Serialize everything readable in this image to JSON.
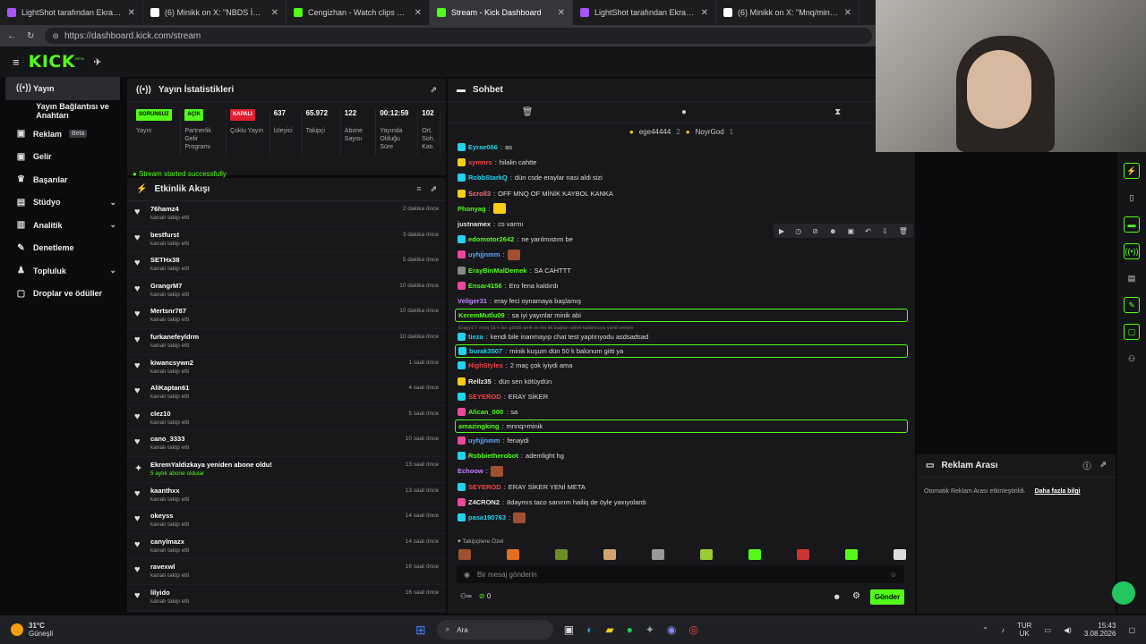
{
  "tabs": [
    {
      "title": "LightShot tarafından Ekran Görün",
      "fav": "#a855f7",
      "active": false
    },
    {
      "title": "(6) Minikk on X: \"NBDS İFSA :) http:",
      "fav": "#ffffff",
      "active": false
    },
    {
      "title": "Cengizhan - Watch clips on Kick",
      "fav": "#53fc18",
      "active": false
    },
    {
      "title": "Stream - Kick Dashboard",
      "fav": "#53fc18",
      "active": true
    },
    {
      "title": "LightShot tarafından Ekran Görün",
      "fav": "#a855f7",
      "active": false
    },
    {
      "title": "(6) Minikk on X: \"Mnq/minik http:",
      "fav": "#ffffff",
      "active": false
    }
  ],
  "url": "https://dashboard.kick.com/stream",
  "logo": "KICK",
  "logo_sup": "BETA",
  "nav": [
    {
      "label": "Yayın",
      "icon": "((•))",
      "active": true,
      "chev": false,
      "beta": false
    },
    {
      "label": "Yayın Bağlantısı ve Anahtarı",
      "icon": "",
      "active": false,
      "chev": false,
      "beta": false
    },
    {
      "label": "Reklam",
      "icon": "▣",
      "active": false,
      "chev": false,
      "beta": true
    },
    {
      "label": "Gelir",
      "icon": "▣",
      "active": false,
      "chev": false,
      "beta": false
    },
    {
      "label": "Başarılar",
      "icon": "♛",
      "active": false,
      "chev": false,
      "beta": false
    },
    {
      "label": "Stüdyo",
      "icon": "▤",
      "active": false,
      "chev": true,
      "beta": false
    },
    {
      "label": "Analitik",
      "icon": "▥",
      "active": false,
      "chev": true,
      "beta": false
    },
    {
      "label": "Denetleme",
      "icon": "✎",
      "active": false,
      "chev": false,
      "beta": false
    },
    {
      "label": "Topluluk",
      "icon": "♟",
      "active": false,
      "chev": true,
      "beta": false
    },
    {
      "label": "Droplar ve ödüller",
      "icon": "▢",
      "active": false,
      "chev": false,
      "beta": false
    }
  ],
  "beta_label": "Beta",
  "stats": {
    "title": "Yayın İstatistikleri",
    "items": [
      {
        "value": "SORUNSUZ",
        "label": "Yayın",
        "badge": "#53fc18"
      },
      {
        "value": "AÇIK",
        "label": "Partnerlik Gelir Programı",
        "badge": "#53fc18"
      },
      {
        "value": "KAPALI",
        "label": "Çoklu Yayın",
        "badge": "#e11d2e"
      },
      {
        "value": "637",
        "label": "İzleyici",
        "badge": ""
      },
      {
        "value": "65.972",
        "label": "Takipçi",
        "badge": ""
      },
      {
        "value": "122",
        "label": "Abone Sayısı",
        "badge": ""
      },
      {
        "value": "00:12:59",
        "label": "Yayında Olduğu Süre",
        "badge": ""
      },
      {
        "value": "102",
        "label": "Ort. Soh. Katı.",
        "badge": ""
      }
    ],
    "ok": "Stream started successfully"
  },
  "activity": {
    "title": "Etkinlik Akışı",
    "rows": [
      {
        "name": "76hamz4",
        "sub": "kanalı takip etti",
        "time": "2 dakika önce",
        "icon": "♥"
      },
      {
        "name": "bestfurst",
        "sub": "kanalı takip etti",
        "time": "3 dakika önce",
        "icon": "♥"
      },
      {
        "name": "SETHx38",
        "sub": "kanalı takip etti",
        "time": "5 dakika önce",
        "icon": "♥"
      },
      {
        "name": "GrangrM7",
        "sub": "kanalı takip etti",
        "time": "10 dakika önce",
        "icon": "♥"
      },
      {
        "name": "Mertsnr787",
        "sub": "kanalı takip etti",
        "time": "10 dakika önce",
        "icon": "♥"
      },
      {
        "name": "furkanefeyldrm",
        "sub": "kanalı takip etti",
        "time": "10 dakika önce",
        "icon": "♥"
      },
      {
        "name": "kiwancsywn2",
        "sub": "kanalı takip etti",
        "time": "1 saat önce",
        "icon": "♥"
      },
      {
        "name": "AliKaptan61",
        "sub": "kanalı takip etti",
        "time": "4 saat önce",
        "icon": "♥"
      },
      {
        "name": "clez10",
        "sub": "kanalı takip etti",
        "time": "5 saat önce",
        "icon": "♥"
      },
      {
        "name": "cano_3333",
        "sub": "kanalı takip etti",
        "time": "10 saat önce",
        "icon": "♥"
      },
      {
        "name": "EkremYaldizkaya yeniden abone oldu!",
        "sub": "5 aylık abone oldular",
        "time": "13 saat önce",
        "icon": "✦"
      },
      {
        "name": "kaanthxx",
        "sub": "kanalı takip etti",
        "time": "13 saat önce",
        "icon": "♥"
      },
      {
        "name": "okeyss",
        "sub": "kanalı takip etti",
        "time": "14 saat önce",
        "icon": "♥"
      },
      {
        "name": "canylmazx",
        "sub": "kanalı takip etti",
        "time": "14 saat önce",
        "icon": "♥"
      },
      {
        "name": "ravexwl",
        "sub": "kanalı takip etti",
        "time": "16 saat önce",
        "icon": "♥"
      },
      {
        "name": "lilyido",
        "sub": "kanalı takip etti",
        "time": "16 saat önce",
        "icon": "♥"
      }
    ]
  },
  "chat": {
    "title": "Sohbet",
    "pinned": [
      {
        "name": "ege44444",
        "n": "2"
      },
      {
        "name": "NoyrGod",
        "n": "1"
      }
    ],
    "messages": [
      {
        "user": "Eyrae066",
        "color": "#22d3ee",
        "text": "as",
        "badge": "#22d3ee",
        "hl": false,
        "emote": false
      },
      {
        "user": "symnrs",
        "color": "#ef4444",
        "text": "hilalin cahtte",
        "badge": "#facc15",
        "hl": false,
        "emote": false
      },
      {
        "user": "RobbStarkQ",
        "color": "#22d3ee",
        "text": "dün csde eraylar nasi aldi sizi",
        "badge": "#22d3ee",
        "hl": false,
        "emote": false
      },
      {
        "user": "Scroll3",
        "color": "#f87171",
        "text": "OFF MNQ OF MİNİK KAYBOL KANKA",
        "badge": "#facc15",
        "hl": false,
        "emote": false
      },
      {
        "user": "Phonyag",
        "color": "#53fc18",
        "text": "",
        "badge": "",
        "hl": false,
        "emote": true
      },
      {
        "user": "justnamex",
        "color": "#e5e5e5",
        "text": "cs varmı",
        "badge": "",
        "hl": false,
        "emote": false
      },
      {
        "user": "edomotor2642",
        "color": "#53fc18",
        "text": "ne yarılmıstım be",
        "badge": "#22d3ee",
        "hl": false,
        "emote": false
      },
      {
        "user": "uyhjjnmm",
        "color": "#60a5fa",
        "text": "",
        "badge": "#ec4899",
        "hl": false,
        "emote": true
      },
      {
        "user": "ErayBinMalDemek",
        "color": "#53fc18",
        "text": "SA CAHTTT",
        "badge": "#888888",
        "hl": false,
        "emote": false
      },
      {
        "user": "Ensar4156",
        "color": "#53fc18",
        "text": "Ero fena kaldırdı",
        "badge": "#ec4899",
        "hl": false,
        "emote": false
      },
      {
        "user": "Veliger31",
        "color": "#c084fc",
        "text": "eray feci oynamaya başlamış",
        "badge": "",
        "hl": false,
        "emote": false
      },
      {
        "user": "KeremMutlu09",
        "color": "#53fc18",
        "text": "sa iyi yayınlar minik abi",
        "badge": "",
        "hl": true,
        "emote": false
      },
      {
        "user": "tieza",
        "color": "#22d3ee",
        "text": "kendi bile inanmayıp chat test yaptırıyodu asdsadsad",
        "badge": "#22d3ee",
        "hl": false,
        "emote": false
      },
      {
        "user": "burak3507",
        "color": "#22d3ee",
        "text": "minik kuşum dün 50 k balonum gitti ya",
        "badge": "#22d3ee",
        "hl": true,
        "emote": false
      },
      {
        "user": "HighStyles",
        "color": "#ef4444",
        "text": "2 maç çok iyiydi ama",
        "badge": "#22d3ee",
        "hl": false,
        "emote": false
      },
      {
        "user": "Rellz35",
        "color": "#e5e5e5",
        "text": "dün sen kötüydün",
        "badge": "#facc15",
        "hl": false,
        "emote": false
      },
      {
        "user": "SEYEROD",
        "color": "#ef4444",
        "text": "ERAY SİKER",
        "badge": "#22d3ee",
        "hl": false,
        "emote": false
      },
      {
        "user": "Alican_000",
        "color": "#53fc18",
        "text": "sa",
        "badge": "#ec4899",
        "hl": false,
        "emote": false
      },
      {
        "user": "amazingking",
        "color": "#53fc18",
        "text": "mnnq>minik",
        "badge": "",
        "hl": true,
        "emote": false
      },
      {
        "user": "uyhjjnmm",
        "color": "#60a5fa",
        "text": "fenaydi",
        "badge": "#ec4899",
        "hl": false,
        "emote": false
      },
      {
        "user": "Robbietherobot",
        "color": "#53fc18",
        "text": "ademlight hg",
        "badge": "#22d3ee",
        "hl": false,
        "emote": false
      },
      {
        "user": "Echoow",
        "color": "#c084fc",
        "text": "",
        "badge": "",
        "hl": false,
        "emote": true
      },
      {
        "user": "SEYEROD",
        "color": "#ef4444",
        "text": "ERAY SİKER YENİ META",
        "badge": "#22d3ee",
        "hl": false,
        "emote": false
      },
      {
        "user": "Z4CRON2",
        "color": "#e5e5e5",
        "text": "8daymıs taco sanırım hailiq de öyle yaxıyolardı",
        "badge": "#ec4899",
        "hl": false,
        "emote": false
      },
      {
        "user": "pasa190763",
        "color": "#22d3ee",
        "text": "",
        "badge": "#22d3ee",
        "hl": false,
        "emote": true
      }
    ],
    "reply_hint": "Erayy17: mnq 15 k ları gördü amk sv nin ilk başları islmli kullanıcıya yand veriyor",
    "followers_only": "♥ Takipçilere Özel",
    "placeholder": "Bir mesaj gönderin",
    "viewer_count": "0",
    "send": "Gönder"
  },
  "reklam": {
    "title": "Reklam Arası",
    "text": "Otomatik Reklam Arası etkinleştirildi.",
    "link": "Daha fazla bilgi"
  },
  "taskbar": {
    "temp": "31°C",
    "weather": "Güneşli",
    "search": "Ara",
    "lang1": "TUR",
    "lang2": "UK",
    "time": "15:43",
    "date": "3.08.2026"
  }
}
